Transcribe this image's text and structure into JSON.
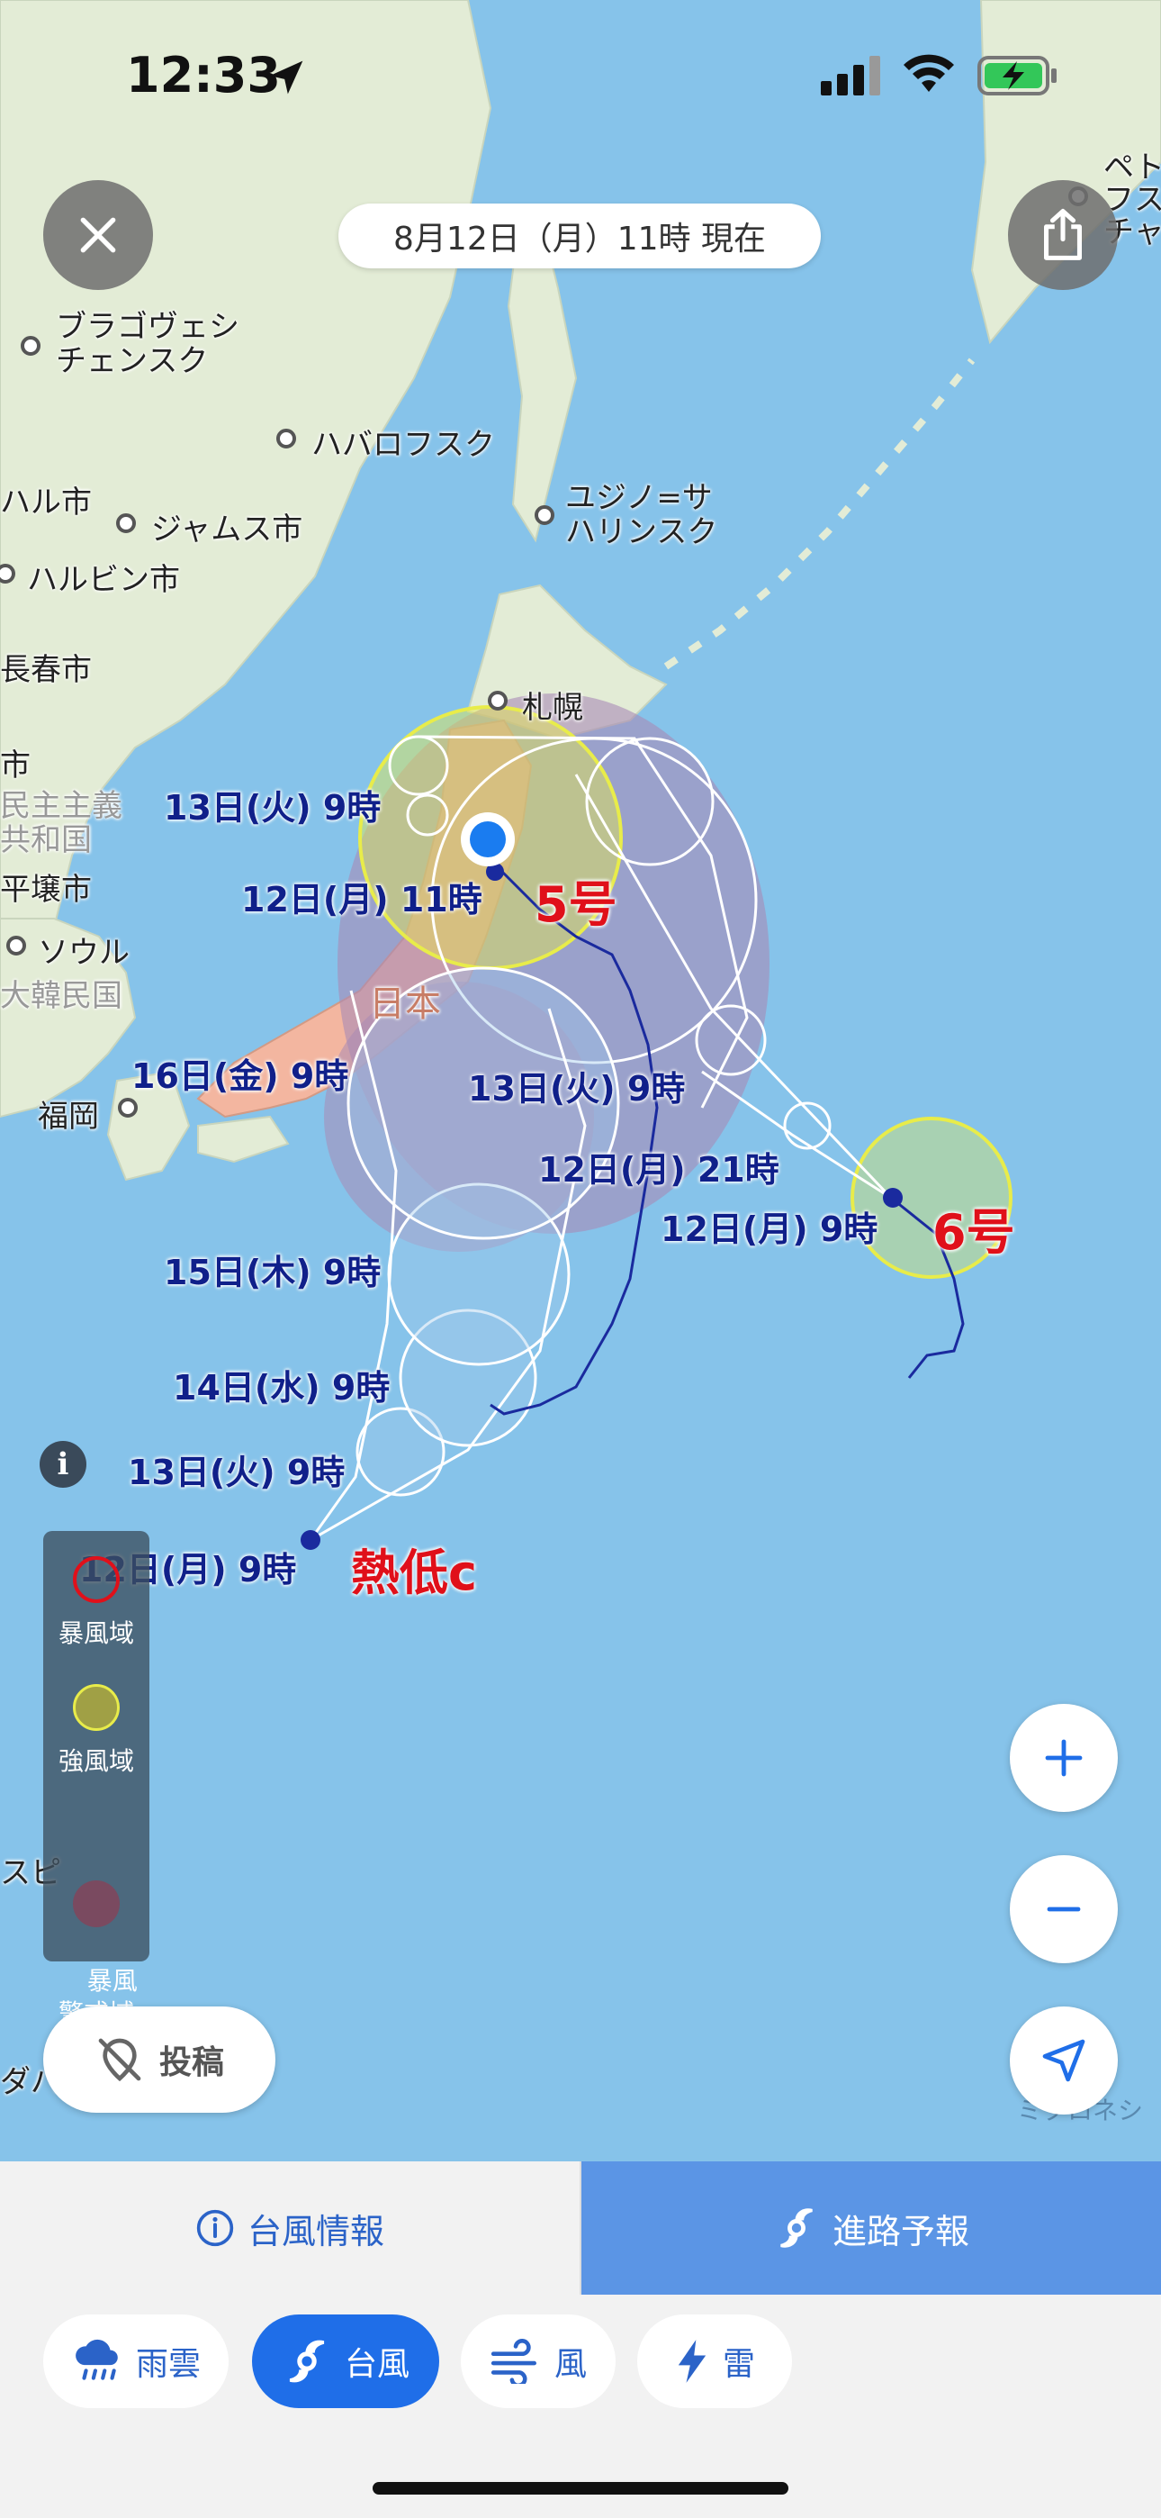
{
  "status": {
    "time": "12:33"
  },
  "header": {
    "date_label": "8月12日（月）11時 現在"
  },
  "map": {
    "places": [
      {
        "id": "blagoveshchensk",
        "text": "ブラゴヴェシ\nチェンスク"
      },
      {
        "id": "khabarovsk",
        "text": "ハバロフスク"
      },
      {
        "id": "harbin_partial",
        "text": "ハル市"
      },
      {
        "id": "jiamusi",
        "text": "ジャムス市"
      },
      {
        "id": "harbin",
        "text": "ハルビン市"
      },
      {
        "id": "yuzhno",
        "text": "ユジノ=サ\nハリンスク"
      },
      {
        "id": "changchun",
        "text": "長春市"
      },
      {
        "id": "sapporo",
        "text": "札幌"
      },
      {
        "id": "dprk",
        "text": "民主主義\n共和国"
      },
      {
        "id": "pyongyang",
        "text": "平壌市"
      },
      {
        "id": "seoul",
        "text": "ソウル"
      },
      {
        "id": "korea",
        "text": "大韓民国"
      },
      {
        "id": "fukuoka",
        "text": "福岡"
      },
      {
        "id": "japan",
        "text": "日本"
      },
      {
        "id": "petro",
        "text": "ペト\nフス\nチャ"
      },
      {
        "id": "city_partial",
        "text": "市"
      },
      {
        "id": "manila_partial",
        "text": "スピ"
      },
      {
        "id": "dava_partial",
        "text": "ダバ"
      },
      {
        "id": "micro_partial",
        "text": "ミクロネシ"
      }
    ],
    "forecast_labels": [
      {
        "id": "t5_13",
        "text": "13日(火) 9時"
      },
      {
        "id": "t5_12",
        "text": "12日(月) 11時"
      },
      {
        "id": "tc_16",
        "text": "16日(金) 9時"
      },
      {
        "id": "tc_13b",
        "text": "13日(火) 9時"
      },
      {
        "id": "t6_21",
        "text": "12日(月) 21時"
      },
      {
        "id": "t6_9",
        "text": "12日(月) 9時"
      },
      {
        "id": "tc_15",
        "text": "15日(木) 9時"
      },
      {
        "id": "tc_14",
        "text": "14日(水) 9時"
      },
      {
        "id": "tc_13",
        "text": "13日(火) 9時"
      },
      {
        "id": "tc_12",
        "text": "12日(月) 9時"
      }
    ],
    "storms": [
      {
        "id": "s5",
        "name": "5号"
      },
      {
        "id": "s6",
        "name": "6号"
      },
      {
        "id": "sc",
        "name": "熱低c"
      }
    ],
    "colors": {
      "sea": "#86c3ea",
      "land": "#e3ecd6",
      "japan": "#f3b6a0",
      "track": "#1a2a9e",
      "storm_area": "#a98ab5",
      "strong_wind": "#e8ec4a",
      "red": "#e0101a"
    },
    "attribution": "ミクロネシ"
  },
  "legend": {
    "items": [
      {
        "label": "暴風域",
        "color": "#e0101a"
      },
      {
        "label": "強風域",
        "color": "#d8d830"
      },
      {
        "label": "暴風\n警戒域",
        "color": "#7a4a60"
      }
    ]
  },
  "post_button": {
    "label": "投稿"
  },
  "tabs": {
    "info": "台風情報",
    "path": "進路予報"
  },
  "chips": [
    {
      "label": "雨雲",
      "icon": "rain-cloud-icon",
      "active": false
    },
    {
      "label": "台風",
      "icon": "typhoon-icon",
      "active": true
    },
    {
      "label": "風",
      "icon": "wind-icon",
      "active": false
    },
    {
      "label": "雷",
      "icon": "lightning-icon",
      "active": false
    }
  ]
}
